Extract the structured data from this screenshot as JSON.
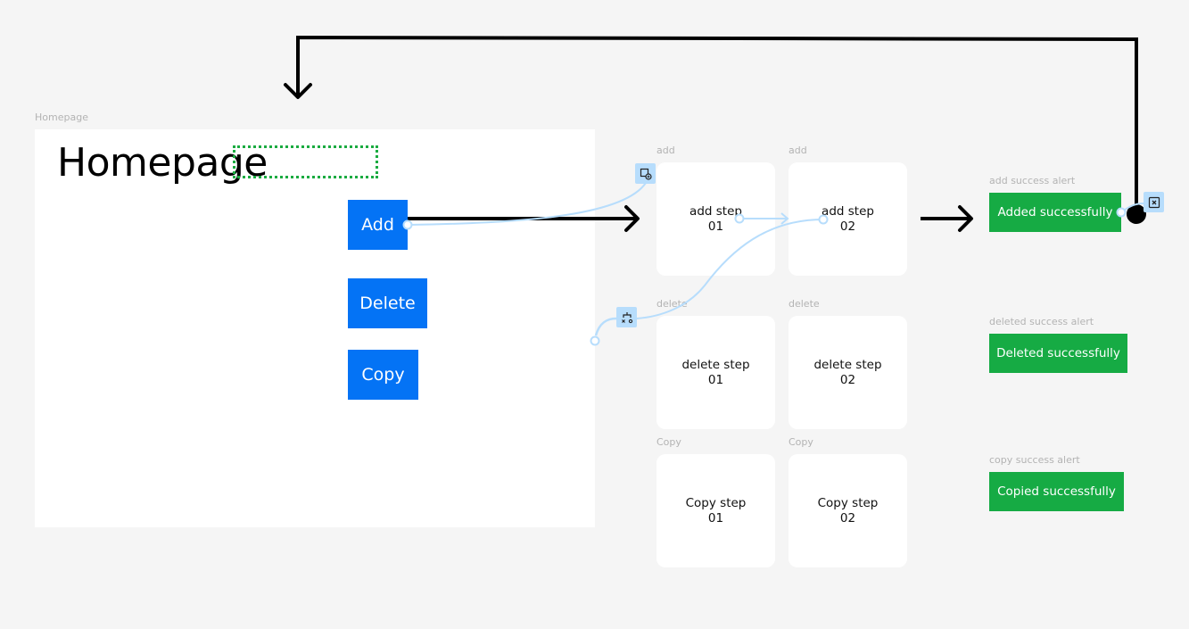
{
  "canvas": {
    "background": "#f5f5f5"
  },
  "homepage": {
    "frame_label": "Homepage",
    "title": "Homepage",
    "buttons": [
      {
        "label": "Add"
      },
      {
        "label": "Delete"
      },
      {
        "label": "Copy"
      }
    ],
    "button_color": "#0473f5"
  },
  "flows": {
    "add": {
      "steps": [
        {
          "frame_label": "add",
          "line1": "add step",
          "line2": "01"
        },
        {
          "frame_label": "add",
          "line1": "add step",
          "line2": "02"
        }
      ],
      "alert": {
        "frame_label": "add success alert",
        "text": "Added successfully"
      }
    },
    "delete": {
      "steps": [
        {
          "frame_label": "delete",
          "line1": "delete step",
          "line2": "01"
        },
        {
          "frame_label": "delete",
          "line1": "delete step",
          "line2": "02"
        }
      ],
      "alert": {
        "frame_label": "deleted success alert",
        "text": "Deleted successfully"
      }
    },
    "copy": {
      "steps": [
        {
          "frame_label": "Copy",
          "line1": "Copy step",
          "line2": "01"
        },
        {
          "frame_label": "Copy",
          "line1": "Copy step",
          "line2": "02"
        }
      ],
      "alert": {
        "frame_label": "copy success alert",
        "text": "Copied successfully"
      }
    }
  },
  "alert_color": "#16ab44",
  "prototype_link_color": "#b7ddfc",
  "icons": {
    "interaction_badge_1": "overlay-open-icon",
    "interaction_badge_2": "conditional-branch-icon",
    "interaction_badge_3": "close-overlay-icon"
  }
}
